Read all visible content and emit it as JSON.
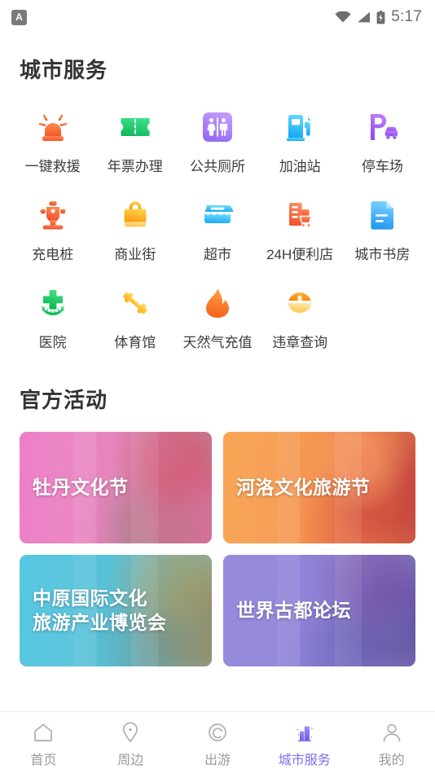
{
  "statusbar": {
    "app_badge": "A",
    "time": "5:17",
    "icons": [
      "wifi-icon",
      "cellular-signal-icon",
      "battery-charging-icon"
    ]
  },
  "city_services": {
    "title": "城市服务",
    "items": [
      {
        "label": "一键救援",
        "icon": "siren-icon",
        "color": "#FF7043"
      },
      {
        "label": "年票办理",
        "icon": "ticket-icon",
        "color": "#22C55E"
      },
      {
        "label": "公共厕所",
        "icon": "restroom-icon",
        "color": "#A87BF5"
      },
      {
        "label": "加油站",
        "icon": "gas-pump-icon",
        "color": "#29B6F6"
      },
      {
        "label": "停车场",
        "icon": "parking-car-icon",
        "color": "#A855F7"
      },
      {
        "label": "充电桩",
        "icon": "charging-post-icon",
        "color": "#FF6F3C"
      },
      {
        "label": "商业街",
        "icon": "shopping-bag-icon",
        "color": "#FFB300"
      },
      {
        "label": "超市",
        "icon": "store-awning-icon",
        "color": "#35BDF5"
      },
      {
        "label": "24H便利店",
        "icon": "convenience-store-icon",
        "color": "#FB6A3C"
      },
      {
        "label": "城市书房",
        "icon": "document-icon",
        "color": "#49B6F7"
      },
      {
        "label": "医院",
        "icon": "hospital-cross-icon",
        "color": "#1DBF5C"
      },
      {
        "label": "体育馆",
        "icon": "dumbbell-icon",
        "color": "#FFC433"
      },
      {
        "label": "天然气充值",
        "icon": "flame-icon",
        "color": "#FB7A2B"
      },
      {
        "label": "违章查询",
        "icon": "police-cap-icon",
        "color": "#FFA020"
      }
    ]
  },
  "official_activities": {
    "title": "官方活动",
    "cards": [
      {
        "lines": [
          "牡丹文化节"
        ],
        "theme": "peony",
        "accent": "#EC71C4"
      },
      {
        "lines": [
          "河洛文化旅游节"
        ],
        "theme": "heluo",
        "accent": "#F8A04A"
      },
      {
        "lines": [
          "中原国际文化",
          "旅游产业博览会"
        ],
        "theme": "expo",
        "accent": "#4CC4E0"
      },
      {
        "lines": [
          "世界古都论坛"
        ],
        "theme": "forum",
        "accent": "#9084DC"
      }
    ]
  },
  "tabbar": {
    "active_index": 3,
    "active_color": "#7B6FF0",
    "inactive_color": "#9A9A9A",
    "items": [
      {
        "label": "首页",
        "icon": "home-icon"
      },
      {
        "label": "周边",
        "icon": "location-pin-icon"
      },
      {
        "label": "出游",
        "icon": "spiral-travel-icon"
      },
      {
        "label": "城市服务",
        "icon": "city-buildings-icon"
      },
      {
        "label": "我的",
        "icon": "person-icon"
      }
    ]
  }
}
